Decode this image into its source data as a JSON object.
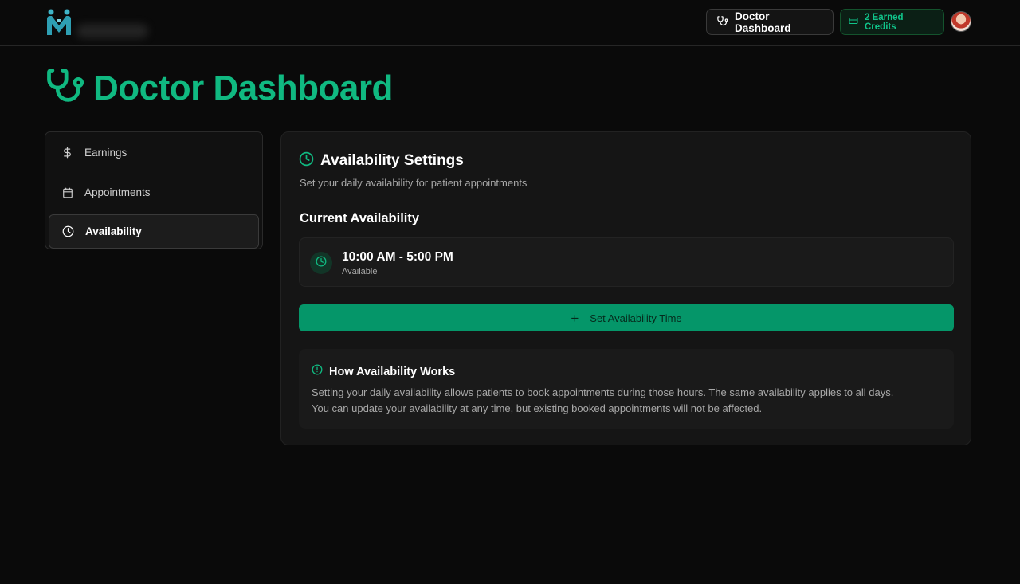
{
  "header": {
    "dashboard_button": "Doctor Dashboard",
    "credits_button": "2 Earned Credits"
  },
  "page": {
    "title": "Doctor Dashboard"
  },
  "sidebar": {
    "items": [
      {
        "label": "Earnings",
        "icon": "dollar-icon",
        "active": false
      },
      {
        "label": "Appointments",
        "icon": "calendar-icon",
        "active": false
      },
      {
        "label": "Availability",
        "icon": "clock-icon",
        "active": true
      }
    ]
  },
  "availability": {
    "title": "Availability Settings",
    "subtitle": "Set your daily availability for patient appointments",
    "current_heading": "Current Availability",
    "slot": {
      "time": "10:00 AM - 5:00 PM",
      "status": "Available"
    },
    "set_button": "Set Availability Time",
    "info": {
      "title": "How Availability Works",
      "line1": "Setting your daily availability allows patients to book appointments during those hours. The same availability applies to all days.",
      "line2": "You can update your availability at any time, but existing booked appointments will not be affected."
    }
  },
  "colors": {
    "accent": "#10b981",
    "button": "#059669",
    "background": "#0a0a0a",
    "panel": "#151515"
  }
}
